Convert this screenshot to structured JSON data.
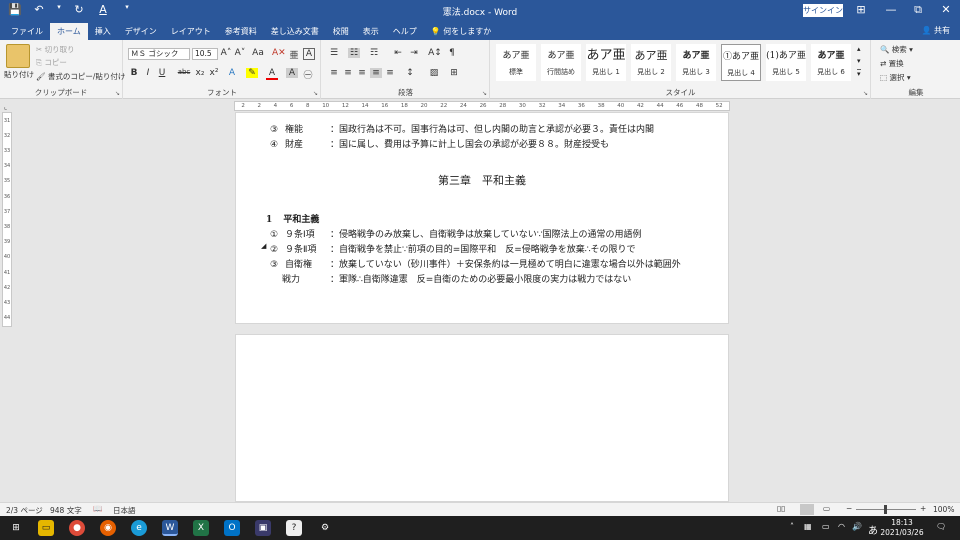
{
  "window": {
    "title": "憲法.docx  -  Word",
    "signin_label": "サインイン",
    "qat_save": "💾",
    "qat_undo": "↶",
    "qat_undo_menu": "▾",
    "qat_redo": "↻",
    "qat_font_color": "A",
    "qat_customize": "▾",
    "ribbon_display": "⊞",
    "minimize": "—",
    "restore": "⧉",
    "close": "✕"
  },
  "tabs": [
    "ファイル",
    "ホーム",
    "挿入",
    "デザイン",
    "レイアウト",
    "参考資料",
    "差し込み文書",
    "校閲",
    "表示",
    "ヘルプ",
    "何をしますか"
  ],
  "tell_me_icon": "💡",
  "share_label": "共有",
  "clipboard": {
    "label": "クリップボード",
    "paste": "貼り付け",
    "cut": "切り取り",
    "copy": "コピー",
    "format_painter": "書式のコピー/貼り付け"
  },
  "font": {
    "label": "フォント",
    "font_name": "ＭＳ ゴシック",
    "font_size": "10.5",
    "grow": "A˄",
    "shrink": "A˅",
    "case": "Aa",
    "clear": "A✕",
    "phonetic": "亜",
    "border": "A",
    "bold": "B",
    "italic": "I",
    "underline": "U",
    "strike": "abc",
    "subscript": "x₂",
    "superscript": "x²",
    "effects": "A",
    "highlight": "✎",
    "color": "A",
    "shade": "A",
    "enclose": "㊀"
  },
  "paragraph": {
    "label": "段落",
    "bullets": "☰",
    "numbering": "☷",
    "multilevel": "☶",
    "decrease_indent": "⇤",
    "increase_indent": "⇥",
    "sort": "A↕",
    "show_marks": "¶",
    "align_left": "≡",
    "align_center": "≡",
    "align_right": "≡",
    "justify": "≡",
    "distribute": "≡",
    "line_spacing": "↕",
    "shading": "▨",
    "borders": "⊞"
  },
  "styles": {
    "label": "スタイル",
    "items": [
      {
        "sample": "あア亜",
        "name": "標準",
        "size": "normal"
      },
      {
        "sample": "あア亜",
        "name": "行間詰め",
        "size": "normal"
      },
      {
        "sample": "あア亜",
        "name": "見出し 1",
        "size": "big"
      },
      {
        "sample": "あア亜",
        "name": "見出し 2",
        "size": "mid"
      },
      {
        "sample": "あア亜",
        "name": "見出し 3",
        "size": "normal"
      },
      {
        "sample": "①あア亜",
        "name": "見出し 4",
        "size": "normal"
      },
      {
        "sample": "(1)あア亜",
        "name": "見出し 5",
        "size": "normal"
      },
      {
        "sample": "あア亜",
        "name": "見出し 6",
        "size": "normal"
      }
    ],
    "scroll_up": "▴",
    "scroll_down": "▾",
    "more": "▾"
  },
  "editing": {
    "label": "編集",
    "find": "検索",
    "replace": "置換",
    "select": "選択"
  },
  "ruler_marks": [
    "2",
    "2",
    "4",
    "6",
    "8",
    "10",
    "12",
    "14",
    "16",
    "18",
    "20",
    "22",
    "24",
    "26",
    "28",
    "30",
    "32",
    "34",
    "36",
    "38",
    "40",
    "42",
    "44",
    "46",
    "48",
    "52"
  ],
  "vruler_marks": [
    "31",
    "32",
    "33",
    "34",
    "35",
    "36",
    "37",
    "38",
    "39",
    "40",
    "41",
    "42",
    "43",
    "44"
  ],
  "document": {
    "top_lines": [
      {
        "num": "③",
        "term": "権能",
        "desc": "：国政行為は不可。国事行為は可、但し内閣の助言と承認が必要３。責任は内閣"
      },
      {
        "num": "④",
        "term": "財産",
        "desc": "：国に属し、費用は予算に計上し国会の承認が必要８８。財産授受も"
      }
    ],
    "chapter_title": "第三章　平和主義",
    "section_num": "1",
    "section_title": "平和主義",
    "items": [
      {
        "num": "①",
        "term": "９条Ⅰ項",
        "desc": "：侵略戦争のみ放棄し、自衛戦争は放棄していない∵国際法上の通常の用語例"
      },
      {
        "num": "②",
        "term": "９条Ⅱ項",
        "desc": "：自衛戦争を禁止∵前項の目的=国際平和　反=侵略戦争を放棄∴その限りで"
      },
      {
        "num": "③",
        "term": "自衛権",
        "desc": "：放棄していない（砂川事件）＋安保条約は一見極めて明白に違憲な場合以外は範囲外"
      },
      {
        "num": "",
        "term": "戦力",
        "desc": "：軍隊∴自衛隊違憲　反=自衛のための必要最小限度の実力は戦力ではない"
      }
    ]
  },
  "status": {
    "page": "2/3 ページ",
    "words": "948 文字",
    "language": "日本語",
    "zoom": "100%",
    "zoom_minus": "−",
    "zoom_plus": "+"
  },
  "taskbar": {
    "time": "18:13",
    "date": "2021/03/26",
    "ime": "あ",
    "app_labels": {
      "explorer": "▭",
      "chrome": "●",
      "firefox": "◉",
      "edge": "e",
      "word": "W",
      "excel": "X",
      "outlook": "O",
      "app_book": "▣",
      "app_help": "?",
      "settings": "⚙"
    }
  },
  "colors": {
    "word_blue": "#2b579a",
    "ribbon_bg": "#f3f3f3",
    "taskbar_bg": "#1f1f1f"
  }
}
